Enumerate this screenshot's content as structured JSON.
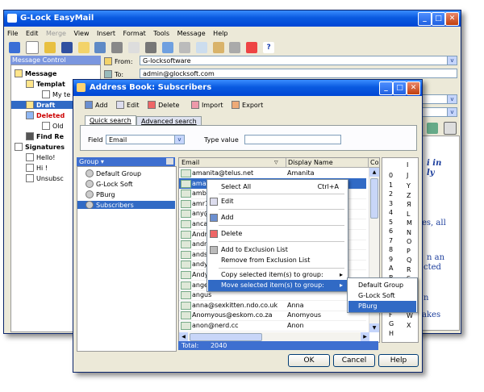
{
  "main": {
    "title": "G-Lock EasyMail",
    "menu": [
      "File",
      "Edit",
      "Merge",
      "View",
      "Insert",
      "Format",
      "Tools",
      "Message",
      "Help"
    ],
    "side_header": "Message Control",
    "tree": [
      {
        "label": "Message",
        "bold": true
      },
      {
        "label": "Templat",
        "bold": true
      },
      {
        "label": "My te",
        "bold": false
      },
      {
        "label": "Draft",
        "bold": true
      },
      {
        "label": "Deleted",
        "bold": true
      },
      {
        "label": "Old",
        "bold": false
      },
      {
        "label": "Find Re",
        "bold": true
      },
      {
        "label": "Signatures",
        "bold": true
      },
      {
        "label": "Hello!",
        "bold": false
      },
      {
        "label": "Hi !",
        "bold": false
      },
      {
        "label": "Unsubsc",
        "bold": false
      }
    ],
    "from_label": "From:",
    "from_value": "G-locksoftware",
    "to_label": "To:",
    "to_value": "admin@glocksoft.com",
    "body_lines": [
      "i in",
      "ly",
      "es, all",
      "n an",
      "cted",
      "n",
      "akes"
    ]
  },
  "dialog": {
    "title": "Address Book: Subscribers",
    "toolbar": [
      "Add",
      "Edit",
      "Delete",
      "Import",
      "Export"
    ],
    "tabs": [
      "Quick search",
      "Advanced search"
    ],
    "field_label": "Field",
    "field_value": "Email",
    "type_value_label": "Type value",
    "type_value": "",
    "group_header": "Group",
    "groups": [
      "Default Group",
      "G-Lock Soft",
      "PBurg",
      "Subscribers"
    ],
    "columns": [
      "Email",
      "Display Name",
      "Co"
    ],
    "rows": [
      {
        "email": "amanita@telus.net",
        "name": "Amanita"
      },
      {
        "email": "amaz",
        "name": ""
      },
      {
        "email": "ambe",
        "name": ""
      },
      {
        "email": "amr12",
        "name": ""
      },
      {
        "email": "any@",
        "name": ""
      },
      {
        "email": "ancar",
        "name": ""
      },
      {
        "email": "Andro",
        "name": ""
      },
      {
        "email": "andr",
        "name": ""
      },
      {
        "email": "ands",
        "name": ""
      },
      {
        "email": "andy",
        "name": ""
      },
      {
        "email": "Andy",
        "name": ""
      },
      {
        "email": "angel",
        "name": ""
      },
      {
        "email": "angus",
        "name": ""
      },
      {
        "email": "anna@sexkitten.ndo.co.uk",
        "name": "Anna"
      },
      {
        "email": "Anomyous@eskom.co.za",
        "name": "Anomyous"
      },
      {
        "email": "anon@nerd.cc",
        "name": "Anon"
      }
    ],
    "alpha_left": [
      "0",
      "1",
      "2",
      "3",
      "4",
      "5",
      "6",
      "7",
      "8",
      "9",
      "A",
      "B",
      "C",
      "D",
      "E",
      "F",
      "G",
      "H"
    ],
    "alpha_right": [
      "Y",
      "Z",
      "Я",
      "L",
      "M",
      "N",
      "O",
      "P",
      "Q",
      "R",
      "S",
      "T",
      "U",
      "V",
      "W",
      "X"
    ],
    "alpha_top": "I",
    "alpha_top2": "J",
    "total_label": "Total:",
    "total_value": "2040",
    "ok": "OK",
    "cancel": "Cancel",
    "help": "Help"
  },
  "context_menu": {
    "items": [
      "Select All",
      "Edit",
      "Add",
      "Delete",
      "Add to Exclusion List",
      "Remove from Exclusion List",
      "Copy selected item(s) to group:",
      "Move selected item(s) to group:"
    ],
    "shortcut": "Ctrl+A"
  },
  "submenu": {
    "items": [
      "Default Group",
      "G-Lock Soft",
      "PBurg"
    ]
  }
}
